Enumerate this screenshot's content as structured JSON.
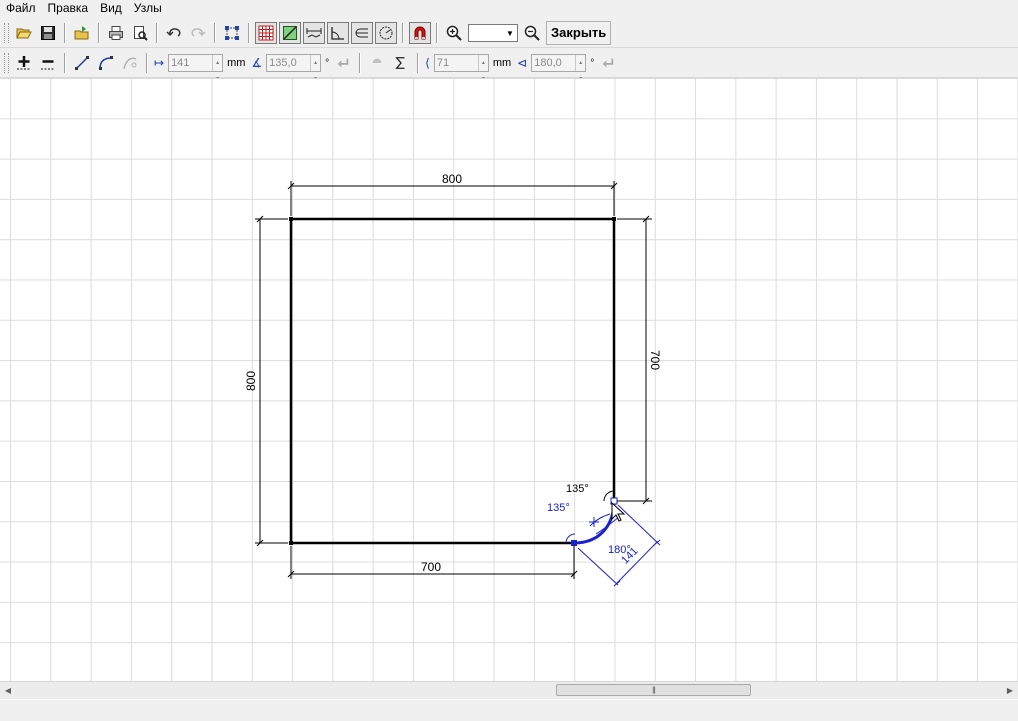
{
  "menu": [
    "Файл",
    "Правка",
    "Вид",
    "Узлы"
  ],
  "toolbar": {
    "close_label": "Закрыть",
    "zoom_value": ""
  },
  "params": {
    "length_value": "141",
    "length_unit": "mm",
    "angle_value": "135,0",
    "radius_value": "71",
    "radius_unit": "mm",
    "arc_angle_value": "180,0",
    "degree_mark": "°"
  },
  "drawing": {
    "dim_top": "800",
    "dim_left": "800",
    "dim_right": "700",
    "dim_bottom": "700",
    "angle_black": "135°",
    "angle_blue": "135°",
    "angle_arc": "180°",
    "chamfer_length": "141"
  },
  "colors": {
    "outline": "#000000",
    "active": "#1a22c8",
    "grid": "#dcdcdc"
  }
}
